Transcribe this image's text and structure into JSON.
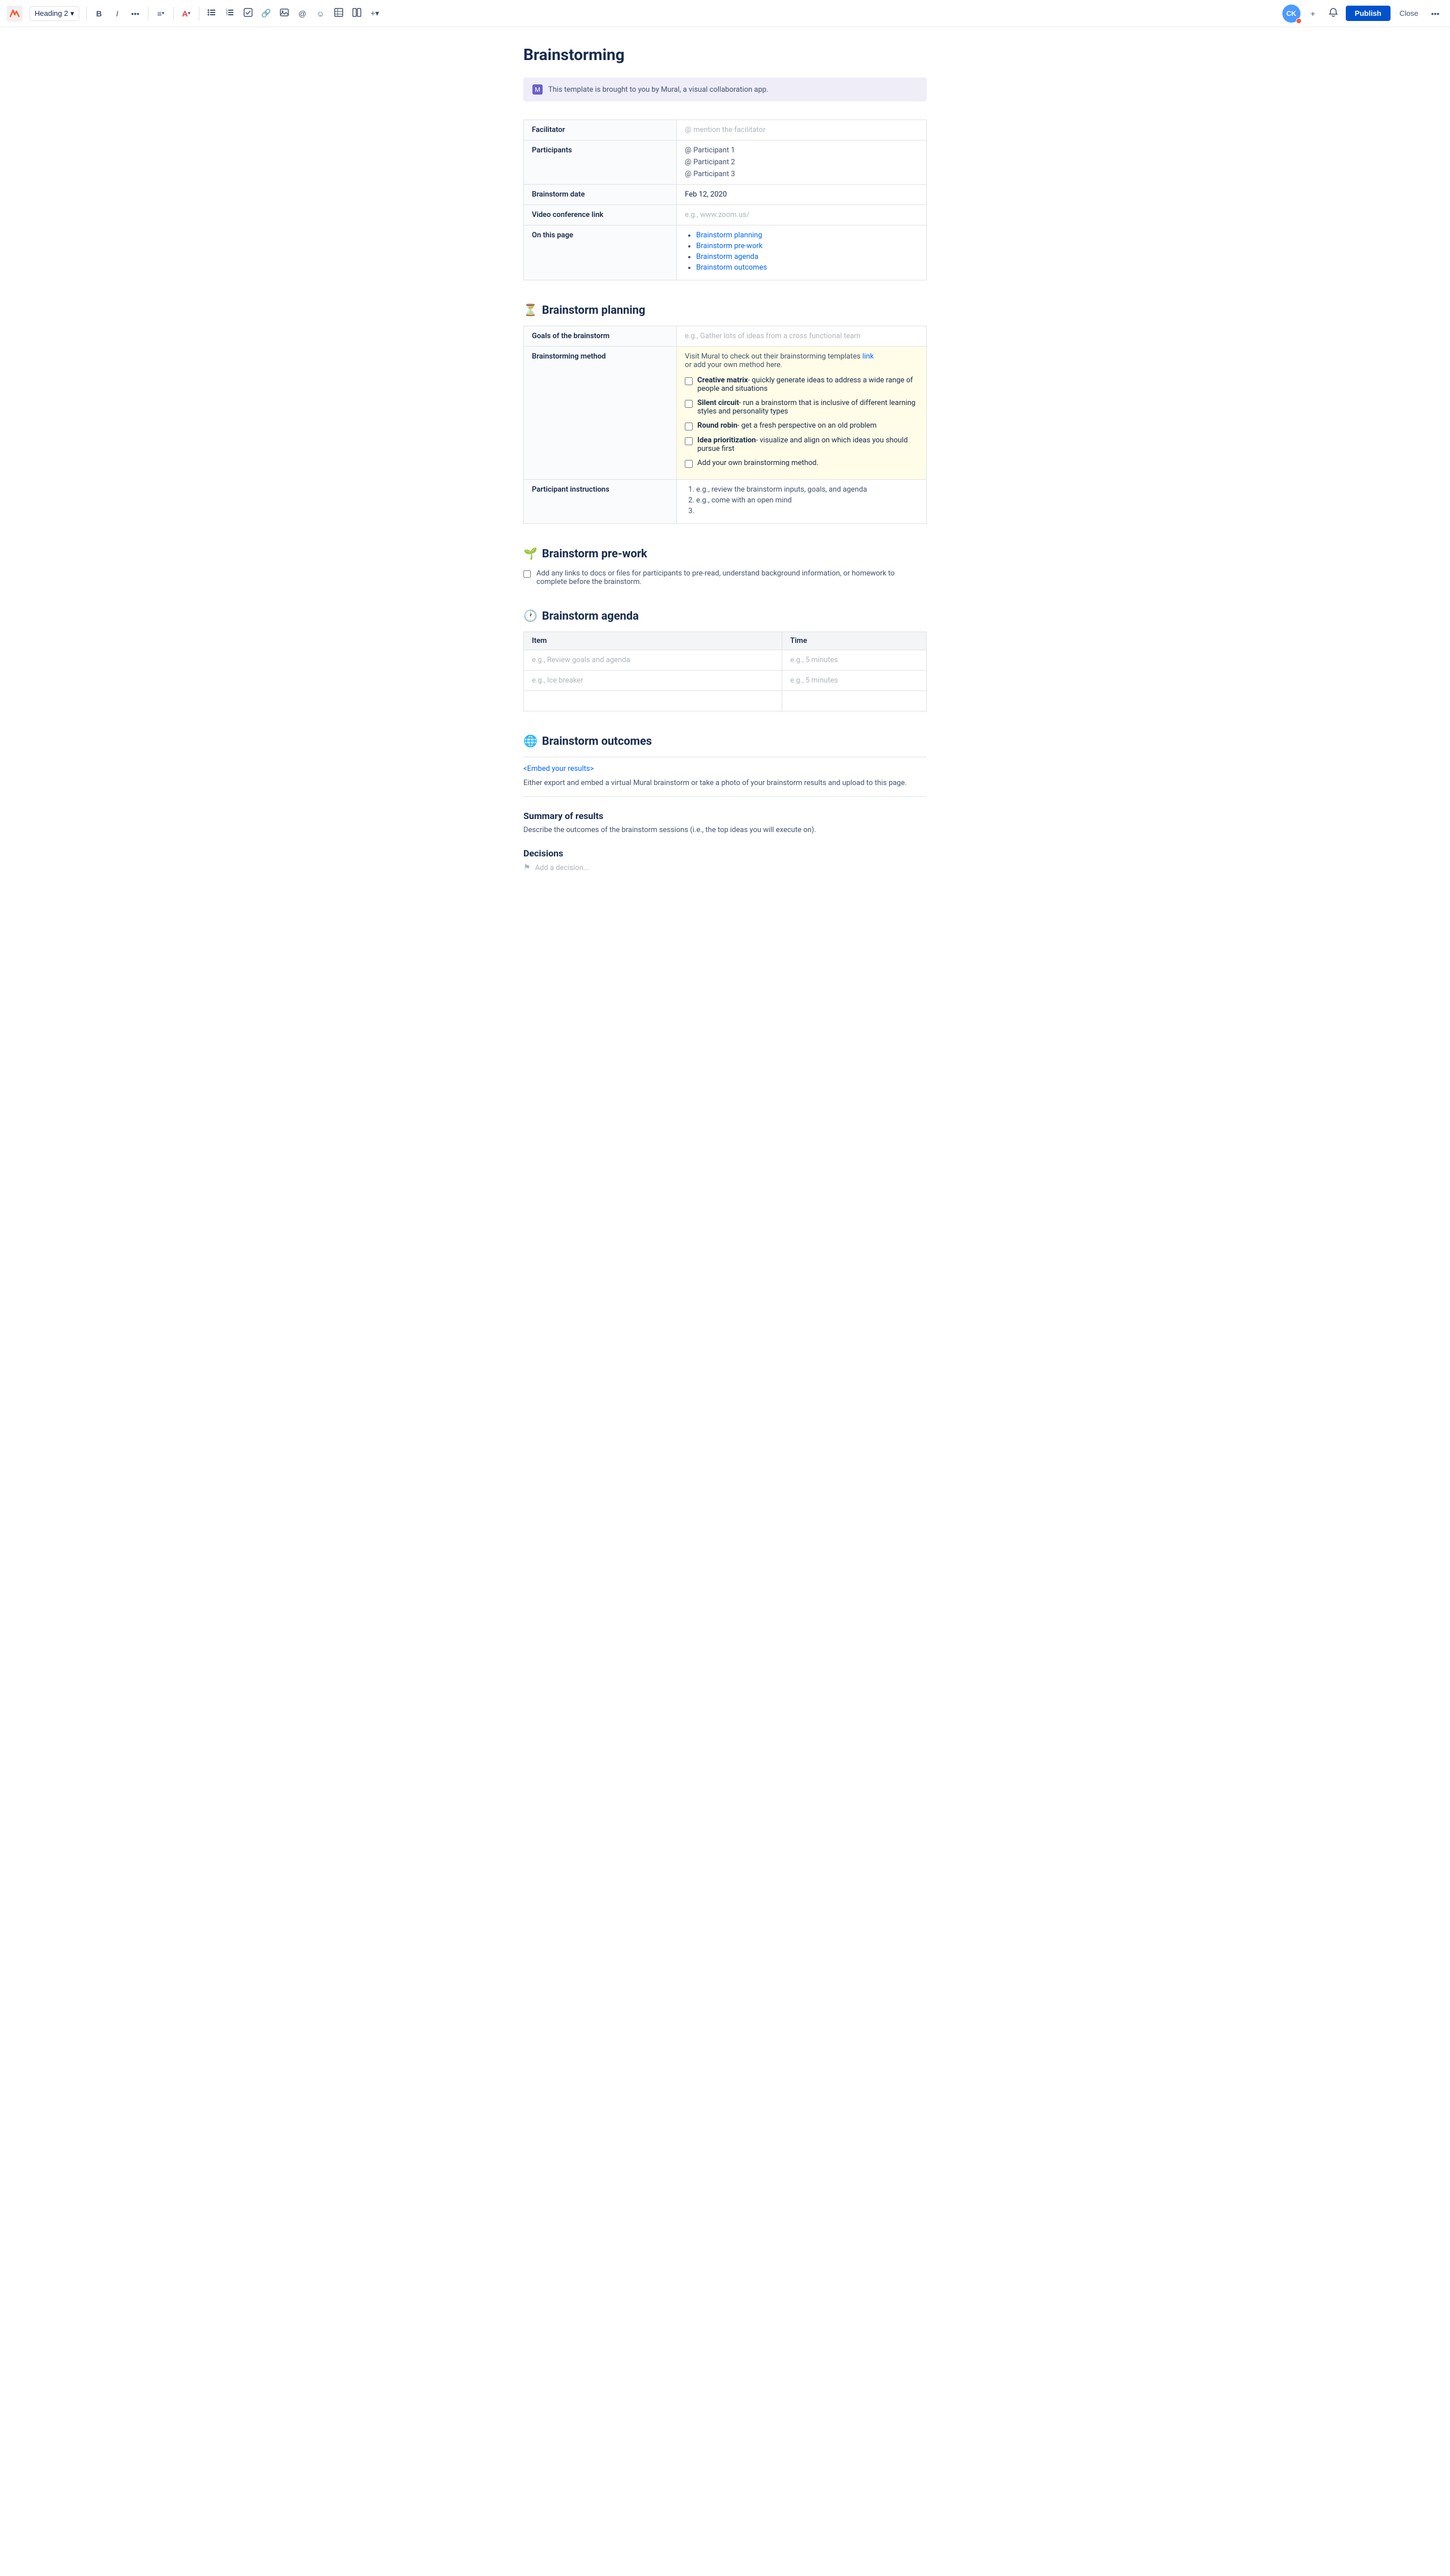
{
  "toolbar": {
    "logo_alt": "Mural logo",
    "heading_label": "Heading 2",
    "bold_label": "B",
    "italic_label": "I",
    "more_label": "•••",
    "align_label": "≡",
    "color_label": "A",
    "bullets_label": "☰",
    "numbered_label": "☰",
    "checkbox_label": "☑",
    "link_label": "🔗",
    "image_label": "🖼",
    "at_label": "@",
    "emoji_label": "☺",
    "table_label": "⊞",
    "columns_label": "⊟",
    "more_tools_label": "+",
    "avatar_initials": "CK",
    "plus_label": "+",
    "bell_label": "🔔",
    "publish_label": "Publish",
    "close_label": "Close",
    "options_label": "•••"
  },
  "page": {
    "title": "Brainstorming"
  },
  "banner": {
    "icon": "M",
    "text": "This template is brought to you by Mural, a visual collaboration app."
  },
  "info_table": {
    "rows": [
      {
        "label": "Facilitator",
        "value": "@ mention the facilitator",
        "placeholder": true
      },
      {
        "label": "Participants",
        "type": "list",
        "items": [
          "@ Participant 1",
          "@ Participant 2",
          "@ Participant 3"
        ]
      },
      {
        "label": "Brainstorm date",
        "value": "Feb 12, 2020",
        "placeholder": false
      },
      {
        "label": "Video conference link",
        "value": "e.g., www.zoom.us/",
        "placeholder": true
      },
      {
        "label": "On this page",
        "type": "links",
        "items": [
          "Brainstorm planning",
          "Brainstorm pre-work",
          "Brainstorm agenda",
          "Brainstorm outcomes"
        ]
      }
    ]
  },
  "planning": {
    "heading": "Brainstorm planning",
    "emoji": "⏳",
    "table": {
      "rows": [
        {
          "label": "Goals of the brainstorm",
          "value": "e.g., Gather lots of ideas from a cross functional team",
          "placeholder": true,
          "type": "text"
        },
        {
          "label": "Brainstorming method",
          "type": "method",
          "intro": "Visit Mural to check out their brainstorming templates",
          "intro_link": "link",
          "intro_cont": " or add your own method here.",
          "options": [
            {
              "label": "Creative matrix",
              "desc": "- quickly generate ideas to address a wide range of people and situations"
            },
            {
              "label": "Silent circuit",
              "desc": "- run a brainstorm that is inclusive of different learning styles and personality types"
            },
            {
              "label": "Round robin",
              "desc": "- get a fresh perspective on an old problem"
            },
            {
              "label": "Idea prioritization",
              "desc": "- visualize and align on which ideas you should pursue first"
            },
            {
              "label": "Add your own brainstorming method.",
              "desc": "",
              "custom": true
            }
          ]
        },
        {
          "label": "Participant instructions",
          "type": "ordered",
          "items": [
            "e.g., review the brainstorm inputs, goals, and agenda",
            "e.g., come with an open mind",
            ""
          ]
        }
      ]
    }
  },
  "prework": {
    "heading": "Brainstorm pre-work",
    "emoji": "🌱",
    "checkbox_text": "Add any links to docs or files for participants to pre-read, understand background information, or homework to complete before the brainstorm."
  },
  "agenda": {
    "heading": "Brainstorm agenda",
    "emoji": "🕐",
    "columns": [
      "Item",
      "Time"
    ],
    "rows": [
      [
        "e.g., Review goals and agenda",
        "e.g., 5 minutes"
      ],
      [
        "e.g., Ice breaker",
        "e.g., 5 minutes"
      ],
      [
        "",
        ""
      ]
    ]
  },
  "outcomes": {
    "heading": "Brainstorm outcomes",
    "emoji": "🌐",
    "embed_link": "<Embed your results>",
    "description": "Either export and embed a virtual Mural brainstorm or take a photo of your brainstorm results and upload to this page.",
    "summary_heading": "Summary of results",
    "summary_desc": "Describe the outcomes of the brainstorm sessions (i.e., the top ideas you will execute on).",
    "decisions_heading": "Decisions",
    "add_decision": "Add a decision..."
  }
}
